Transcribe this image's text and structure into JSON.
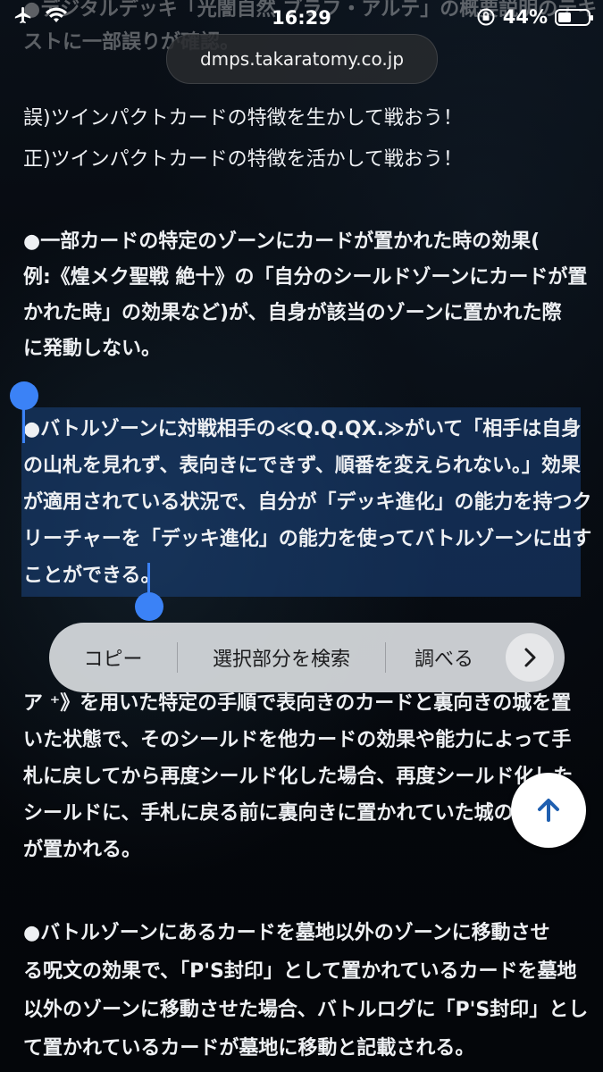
{
  "status_bar": {
    "time": "16:29",
    "battery_percent": "44%",
    "battery_level": 0.44
  },
  "browser": {
    "url": "dmps.takaratomy.co.jp"
  },
  "article": {
    "intro_lines": [
      "●デジタルデッキ「光闇自然 ブラフ・アルテ」の概要説明のテキ",
      "ストに一部誤りが確認。"
    ],
    "wrong_line": "誤)ツインパクトカードの特徴を生かして戦おう！",
    "correct_line": "正)ツインパクトカードの特徴を活かして戦おう！",
    "bug1_lines": [
      "●一部カードの特定のゾーンにカードが置かれた時の効果(",
      "例:《煌メク聖戦 絶十》の「自分のシールドゾーンにカードが置",
      "かれた時」の効果など)が、自身が該当のゾーンに置かれた際",
      "に発動しない。"
    ],
    "bug2_lines": [
      "●バトルゾーンに対戦相手の≪Q.Q.QX.≫がいて「相手は自身",
      "の山札を見れず、表向きにできず、順番を変えられない。」効果",
      "が適用されている状況で、自分が「デッキ進化」の能力を持つク",
      "リーチャーを「デッキ進化」の能力を使ってバトルゾーンに出す",
      "ことができる。"
    ],
    "bug3_lines": [
      "ア ⁺》を用いた特定の手順で表向きのカードと裏向きの城を置",
      "いた状態で、そのシールドを他カードの効果や能力によって手",
      "札に戻してから再度シールド化した場合、再度シールド化した",
      "シールドに、手札に戻る前に裏向きに置かれていた城の",
      "が置かれる。"
    ],
    "bug4_lines": [
      "●バトルゾーンにあるカードを墓地以外のゾーンに移動させ",
      "る呪文の効果で、「P'S封印」として置かれているカードを墓地",
      "以外のゾーンに移動させた場合、バトルログに「P'S封印」とし",
      "て置かれているカードが墓地に移動と記載される。"
    ]
  },
  "context_menu": {
    "copy": "コピー",
    "search_selection": "選択部分を検索",
    "look_up": "調べる",
    "more_icon": "chevron-right-icon"
  },
  "scroll_top_icon": "arrow-up-icon",
  "colors": {
    "selection": "#1c4682",
    "handle": "#3b82f6",
    "scroll_arrow": "#1f5fb0"
  }
}
